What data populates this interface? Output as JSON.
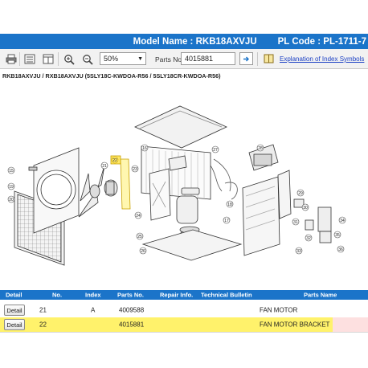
{
  "header": {
    "model_name": "Model Name : RKB18AXVJU",
    "pl_code": "PL Code : PL-1711-7"
  },
  "toolbar": {
    "zoom_value": "50%",
    "parts_no_label": "Parts No.",
    "parts_no_value": "4015881",
    "explanation_link": "Explanation of Index Symbols"
  },
  "model_line": "RKB18AXVJU / RXB18AXVJU (5SLY18C-KWDOA-R56 / 5SLY18CR-KWDOA-R56)",
  "diagram": {
    "callouts": [
      "15",
      "19",
      "20",
      "21",
      "22",
      "23",
      "24",
      "16",
      "17",
      "18",
      "25",
      "26",
      "27",
      "28",
      "29",
      "30",
      "31",
      "32",
      "33",
      "34",
      "35",
      "36"
    ]
  },
  "table": {
    "headers": [
      "Detail",
      "No.",
      "Index",
      "Parts No.",
      "Repair Info.",
      "Technical Bulletin",
      "Parts Name"
    ],
    "rows": [
      {
        "detail": "Detail",
        "no": "21",
        "index": "A",
        "parts_no": "4009588",
        "repair": "",
        "bulletin": "",
        "name": "FAN MOTOR"
      },
      {
        "detail": "Detail",
        "no": "22",
        "index": "",
        "parts_no": "4015881",
        "repair": "",
        "bulletin": "",
        "name": "FAN MOTOR BRACKET"
      }
    ]
  },
  "colors": {
    "header_blue": "#1b74c9",
    "selected_row": "#fff26b",
    "link_blue": "#1a3fc4"
  }
}
